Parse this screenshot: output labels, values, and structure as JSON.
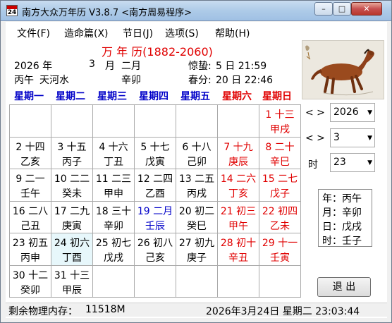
{
  "window": {
    "title": "南方大众万年历  V3.8.7 <南方周易程序>",
    "icon_text": "24"
  },
  "menu": [
    "文件(F)",
    "造命篇(X)",
    "节日(J)",
    "选项(S)",
    "帮助(H)"
  ],
  "header": {
    "calendar_title": "万 年 历(1882-2060)",
    "year": "2026 年",
    "month_num": "3",
    "month_label": "月",
    "lunar_month": "二月",
    "year_ganzhi": "丙午",
    "nayin": "天河水",
    "month_ganzhi": "辛卯",
    "term1_label": "惊蛰:",
    "term1_value": "5  日  21:59",
    "term2_label": "春分:",
    "term2_value": "20 日  22:46"
  },
  "weekdays": [
    {
      "label": "星期一",
      "color": "#0000c8"
    },
    {
      "label": "星期二",
      "color": "#0000c8"
    },
    {
      "label": "星期三",
      "color": "#0000c8"
    },
    {
      "label": "星期四",
      "color": "#0000c8"
    },
    {
      "label": "星期五",
      "color": "#0000c8"
    },
    {
      "label": "星期六",
      "color": "#e00000"
    },
    {
      "label": "星期日",
      "color": "#e00000"
    }
  ],
  "days": [
    {
      "line1": "1 十三",
      "line2": "甲戌",
      "col": 6,
      "row": 0,
      "style": "red"
    },
    {
      "line1": "2 十四",
      "line2": "乙亥",
      "col": 0,
      "row": 1,
      "style": "dark"
    },
    {
      "line1": "3 十五",
      "line2": "丙子",
      "col": 1,
      "row": 1,
      "style": "dark"
    },
    {
      "line1": "4 十六",
      "line2": "丁丑",
      "col": 2,
      "row": 1,
      "style": "dark"
    },
    {
      "line1": "5 十七",
      "line2": "戊寅",
      "col": 3,
      "row": 1,
      "style": "dark"
    },
    {
      "line1": "6 十八",
      "line2": "己卯",
      "col": 4,
      "row": 1,
      "style": "dark"
    },
    {
      "line1": "7 十九",
      "line2": "庚辰",
      "col": 5,
      "row": 1,
      "style": "red"
    },
    {
      "line1": "8 二十",
      "line2": "辛巳",
      "col": 6,
      "row": 1,
      "style": "red"
    },
    {
      "line1": "9 二一",
      "line2": "壬午",
      "col": 0,
      "row": 2,
      "style": "dark"
    },
    {
      "line1": "10 二二",
      "line2": "癸未",
      "col": 1,
      "row": 2,
      "style": "dark"
    },
    {
      "line1": "11 二三",
      "line2": "甲申",
      "col": 2,
      "row": 2,
      "style": "dark"
    },
    {
      "line1": "12 二四",
      "line2": "乙酉",
      "col": 3,
      "row": 2,
      "style": "dark"
    },
    {
      "line1": "13 二五",
      "line2": "丙戌",
      "col": 4,
      "row": 2,
      "style": "dark"
    },
    {
      "line1": "14 二六",
      "line2": "丁亥",
      "col": 5,
      "row": 2,
      "style": "red"
    },
    {
      "line1": "15 二七",
      "line2": "戊子",
      "col": 6,
      "row": 2,
      "style": "red"
    },
    {
      "line1": "16 二八",
      "line2": "己丑",
      "col": 0,
      "row": 3,
      "style": "dark"
    },
    {
      "line1": "17 二九",
      "line2": "庚寅",
      "col": 1,
      "row": 3,
      "style": "dark"
    },
    {
      "line1": "18 三十",
      "line2": "辛卯",
      "col": 2,
      "row": 3,
      "style": "dark"
    },
    {
      "line1": "19 二月",
      "line2": "壬辰",
      "col": 3,
      "row": 3,
      "style": "blue"
    },
    {
      "line1": "20 初二",
      "line2": "癸巳",
      "col": 4,
      "row": 3,
      "style": "dark"
    },
    {
      "line1": "21 初三",
      "line2": "甲午",
      "col": 5,
      "row": 3,
      "style": "red"
    },
    {
      "line1": "22 初四",
      "line2": "乙未",
      "col": 6,
      "row": 3,
      "style": "red"
    },
    {
      "line1": "23 初五",
      "line2": "丙申",
      "col": 0,
      "row": 4,
      "style": "dark"
    },
    {
      "line1": "24 初六",
      "line2": "丁酉",
      "col": 1,
      "row": 4,
      "style": "dark",
      "today": true
    },
    {
      "line1": "25 初七",
      "line2": "戊戌",
      "col": 2,
      "row": 4,
      "style": "dark"
    },
    {
      "line1": "26 初八",
      "line2": "己亥",
      "col": 3,
      "row": 4,
      "style": "dark"
    },
    {
      "line1": "27 初九",
      "line2": "庚子",
      "col": 4,
      "row": 4,
      "style": "dark"
    },
    {
      "line1": "28 初十",
      "line2": "辛丑",
      "col": 5,
      "row": 4,
      "style": "red"
    },
    {
      "line1": "29 十一",
      "line2": "壬寅",
      "col": 6,
      "row": 4,
      "style": "red"
    },
    {
      "line1": "30 十二",
      "line2": "癸卯",
      "col": 0,
      "row": 5,
      "style": "dark"
    },
    {
      "line1": "31 十三",
      "line2": "甲辰",
      "col": 1,
      "row": 5,
      "style": "dark"
    }
  ],
  "controls": {
    "nav1": "< >",
    "year_select": "2026",
    "nav2": "< >",
    "month_select": "3",
    "hour_label": "时",
    "hour_select": "23"
  },
  "ganzhi": {
    "year": "年：丙午",
    "month": "月：辛卯",
    "day": "日：戊戌",
    "hour": "时：壬子"
  },
  "exit_label": "退 出",
  "status": {
    "memory_label": "剩余物理内存：",
    "memory_value": "11518M",
    "datetime": "2026年3月24日 星期二 23:03:44"
  },
  "colors": {
    "red": "#e00000",
    "blue": "#0000c8",
    "today_bg": "#e7f7fb"
  }
}
